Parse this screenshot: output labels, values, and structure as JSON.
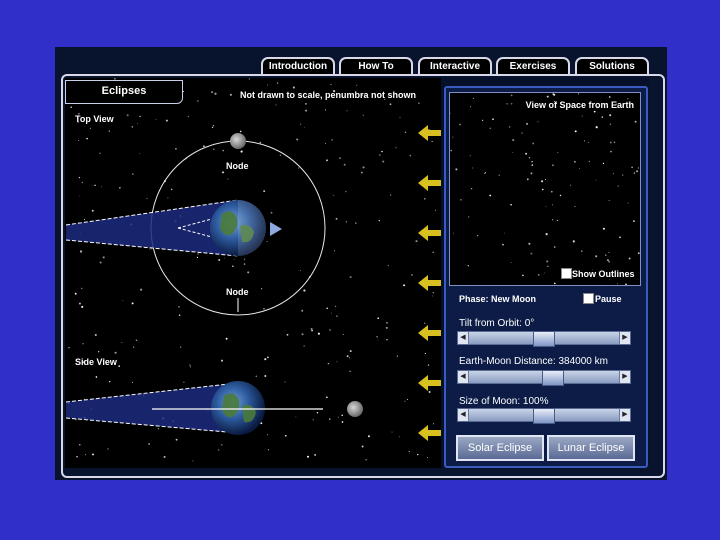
{
  "tabs": [
    {
      "label": "Introduction"
    },
    {
      "label": "How To"
    },
    {
      "label": "Interactive"
    },
    {
      "label": "Exercises"
    },
    {
      "label": "Solutions"
    }
  ],
  "active_tab": "Interactive",
  "section_label": "Eclipses",
  "note": "Not drawn to scale, penumbra not shown",
  "top_view": {
    "title": "Top View",
    "node_top": "Node",
    "node_bottom": "Node"
  },
  "side_view": {
    "title": "Side View"
  },
  "space_view": {
    "title": "View of Space from Earth",
    "outlines_label": "Show Outlines",
    "outlines_checked": false
  },
  "phase": {
    "label": "Phase: New Moon"
  },
  "pause": {
    "label": "Pause",
    "checked": false
  },
  "sliders": [
    {
      "label": "Tilt from Orbit: 0°",
      "position": 0.5
    },
    {
      "label": "Earth-Moon Distance: 384000 km",
      "position": 0.55
    },
    {
      "label": "Size of Moon: 100%",
      "position": 0.5
    }
  ],
  "buttons": {
    "solar": "Solar Eclipse",
    "lunar": "Lunar Eclipse"
  },
  "colors": {
    "background": "#3030c8",
    "accent": "#3a5cc0",
    "sun_arrow": "#d8c020"
  }
}
